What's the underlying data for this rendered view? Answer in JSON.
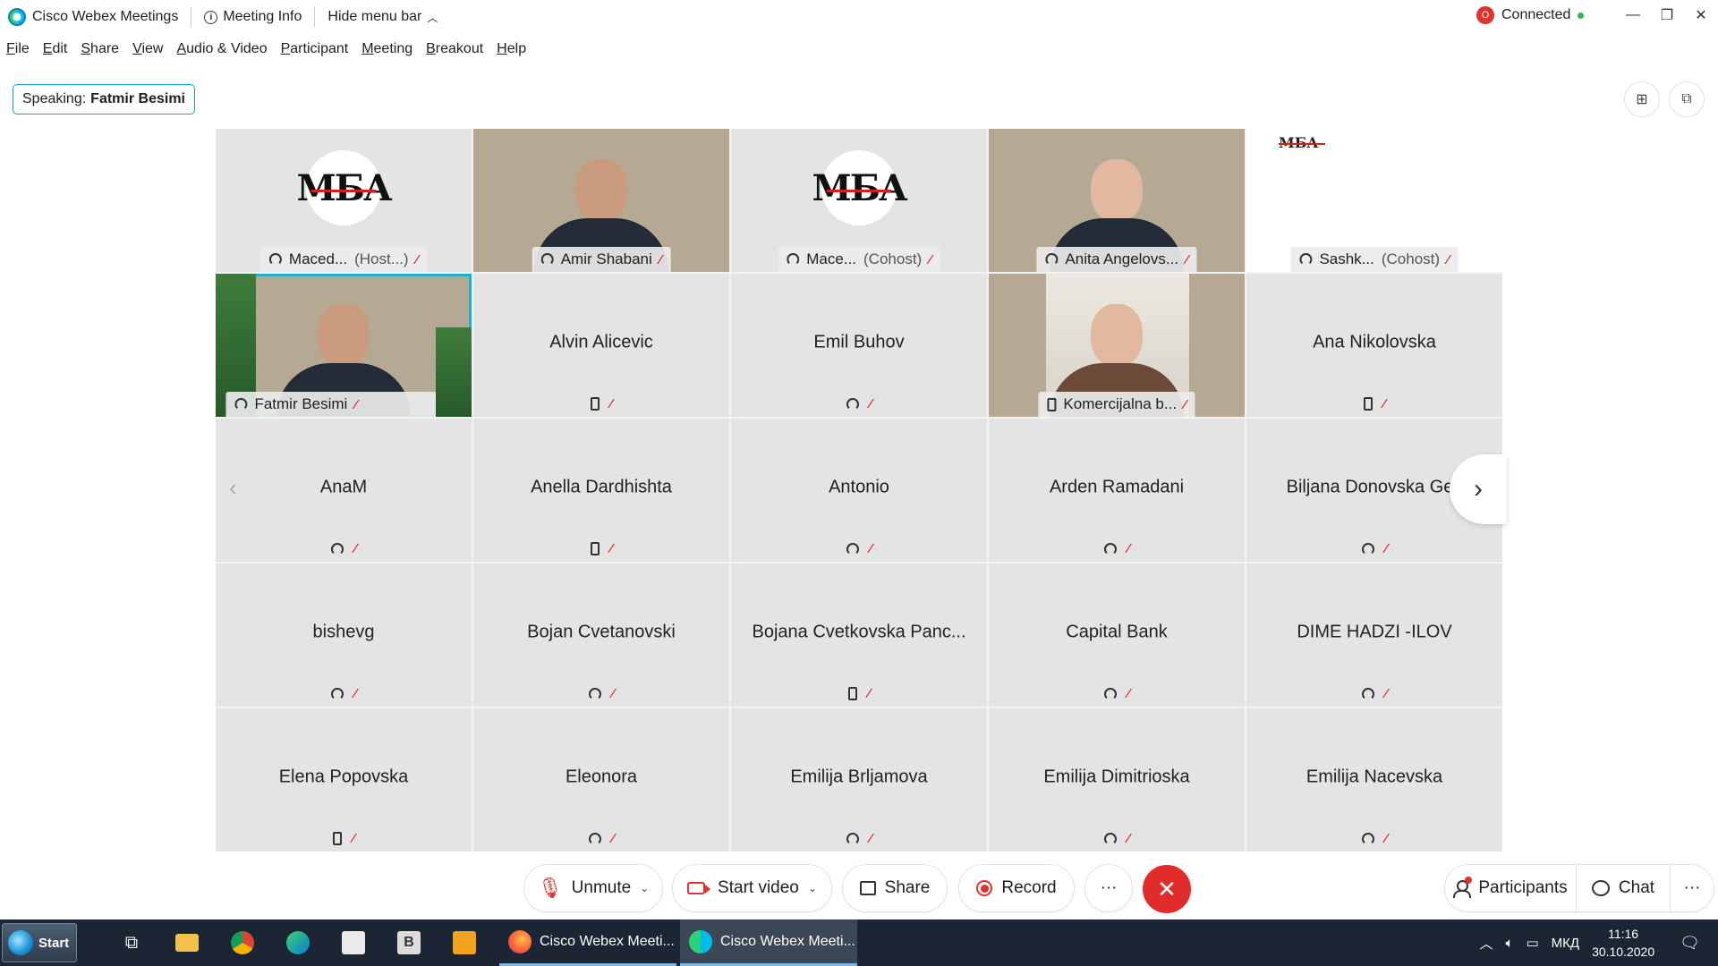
{
  "window": {
    "app_title": "Cisco Webex Meetings",
    "meeting_info": "Meeting Info",
    "hide_menu": "Hide menu bar",
    "connection_status": "Connected",
    "rec_badge": "O"
  },
  "menu": [
    "File",
    "Edit",
    "Share",
    "View",
    "Audio & Video",
    "Participant",
    "Meeting",
    "Breakout",
    "Help"
  ],
  "speaking": {
    "label": "Speaking:",
    "name": "Fatmir Besimi"
  },
  "logo_text": "МБА",
  "tiles": [
    {
      "name": "Maced...",
      "role": "(Host...)",
      "type": "logo",
      "icon": "headset"
    },
    {
      "name": "Amir Shabani",
      "role": "",
      "type": "video",
      "icon": "headset"
    },
    {
      "name": "Mace...",
      "role": "(Cohost)",
      "type": "logo",
      "icon": "headset"
    },
    {
      "name": "Anita Angelovs...",
      "role": "",
      "type": "video",
      "icon": "headset"
    },
    {
      "name": "Sashk...",
      "role": "(Cohost)",
      "type": "slide",
      "icon": "headset"
    },
    {
      "name": "Fatmir Besimi",
      "role": "",
      "type": "video",
      "icon": "headset",
      "selected": true
    },
    {
      "name": "Alvin Alicevic",
      "type": "avatar",
      "icon": "phone"
    },
    {
      "name": "Emil Buhov",
      "type": "avatar",
      "icon": "headset"
    },
    {
      "name": "Komercijalna b...",
      "role": "",
      "type": "video",
      "icon": "phone"
    },
    {
      "name": "Ana Nikolovska",
      "type": "avatar",
      "icon": "phone"
    },
    {
      "name": "AnaM",
      "type": "avatar",
      "icon": "headset"
    },
    {
      "name": "Anella Dardhishta",
      "type": "avatar",
      "icon": "phone"
    },
    {
      "name": "Antonio",
      "type": "avatar",
      "icon": "headset"
    },
    {
      "name": "Arden Ramadani",
      "type": "avatar",
      "icon": "headset"
    },
    {
      "name": "Biljana Donovska Gec",
      "type": "avatar",
      "icon": "headset"
    },
    {
      "name": "bishevg",
      "type": "avatar",
      "icon": "headset"
    },
    {
      "name": "Bojan Cvetanovski",
      "type": "avatar",
      "icon": "headset"
    },
    {
      "name": "Bojana Cvetkovska Panc...",
      "type": "avatar",
      "icon": "phone"
    },
    {
      "name": "Capital Bank",
      "type": "avatar",
      "icon": "headset"
    },
    {
      "name": "DIME HADZI -ILOV",
      "type": "avatar",
      "icon": "headset"
    },
    {
      "name": "Elena Popovska",
      "type": "avatar",
      "icon": "phone"
    },
    {
      "name": "Eleonora",
      "type": "avatar",
      "icon": "headset"
    },
    {
      "name": "Emilija Brljamova",
      "type": "avatar",
      "icon": "headset"
    },
    {
      "name": "Emilija Dimitrioska",
      "type": "avatar",
      "icon": "headset"
    },
    {
      "name": "Emilija Nacevska",
      "type": "avatar",
      "icon": "headset"
    }
  ],
  "toolbar": {
    "unmute": "Unmute",
    "start_video": "Start video",
    "share": "Share",
    "record": "Record",
    "more": "···",
    "participants": "Participants",
    "chat": "Chat"
  },
  "taskbar": {
    "start": "Start",
    "apps": [
      "Cisco Webex Meeti...",
      "Cisco Webex Meeti..."
    ],
    "language": "МКД",
    "time": "11:16",
    "date": "30.10.2020"
  },
  "colors": {
    "accent": "#12a5c7",
    "muted_red": "#e0322e",
    "end_call": "#e22b2b"
  }
}
